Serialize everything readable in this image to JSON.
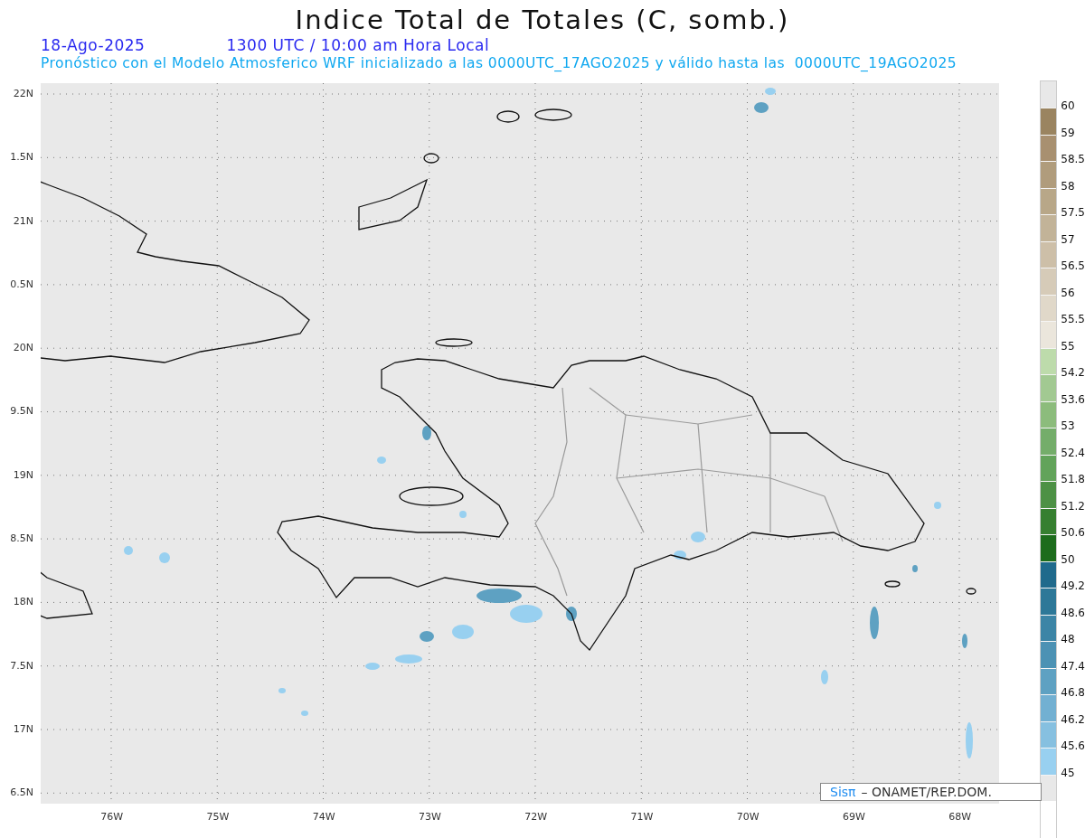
{
  "title": "Indice Total de Totales (C, somb.)",
  "date": "18-Ago-2025",
  "time": "1300 UTC / 10:00 am Hora Local",
  "subtitle": "Pronóstico con el Modelo Atmosferico WRF inicializado a las 0000UTC_17AGO2025 y válido hasta las  0000UTC_19AGO2025",
  "y_labels": [
    "22N",
    "1.5N",
    "21N",
    "0.5N",
    "20N",
    "9.5N",
    "19N",
    "8.5N",
    "18N",
    "7.5N",
    "17N",
    "6.5N"
  ],
  "x_labels": [
    "76W",
    "75W",
    "74W",
    "73W",
    "72W",
    "71W",
    "70W",
    "69W",
    "68W"
  ],
  "credit": {
    "brand": "Sisπ",
    "text": "– ONAMET/REP.DOM."
  },
  "legend": [
    {
      "label": "60",
      "color": "#9a8460"
    },
    {
      "label": "59",
      "color": "#a89070"
    },
    {
      "label": "58.5",
      "color": "#b09c7c"
    },
    {
      "label": "58",
      "color": "#b8a788"
    },
    {
      "label": "57.5",
      "color": "#c2b398"
    },
    {
      "label": "57",
      "color": "#cdbfa8"
    },
    {
      "label": "56.5",
      "color": "#d6cbb8"
    },
    {
      "label": "56",
      "color": "#e0d8c9"
    },
    {
      "label": "55.5",
      "color": "#ebe6dc"
    },
    {
      "label": "55",
      "color": "#bddbab"
    },
    {
      "label": "54.2",
      "color": "#a2c992"
    },
    {
      "label": "53.6",
      "color": "#8cbc7c"
    },
    {
      "label": "53",
      "color": "#74ad6a"
    },
    {
      "label": "52.4",
      "color": "#62a35a"
    },
    {
      "label": "51.8",
      "color": "#4d9145"
    },
    {
      "label": "51.2",
      "color": "#367f30"
    },
    {
      "label": "50.6",
      "color": "#1d6c1c"
    },
    {
      "label": "50",
      "color": "#206a8c"
    },
    {
      "label": "49.2",
      "color": "#2d7898"
    },
    {
      "label": "48.6",
      "color": "#3c85a6"
    },
    {
      "label": "48",
      "color": "#4c92b4"
    },
    {
      "label": "47.4",
      "color": "#5ea1c2"
    },
    {
      "label": "46.8",
      "color": "#72b0d2"
    },
    {
      "label": "46.2",
      "color": "#86c0e0"
    },
    {
      "label": "45.6",
      "color": "#98d0f0"
    },
    {
      "label": "45",
      "color": "#e8e8e8"
    }
  ]
}
